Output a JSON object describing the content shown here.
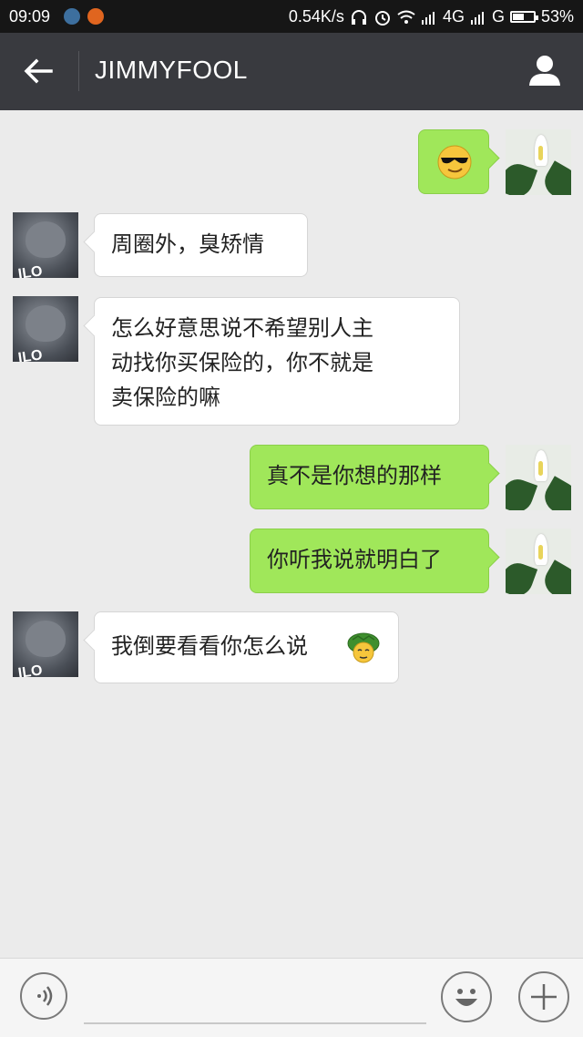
{
  "status_bar": {
    "time": "09:09",
    "network_speed": "0.54K/s",
    "network_4g": "4G",
    "network_g": "G",
    "battery": "53%",
    "battery_level": 0.53
  },
  "header": {
    "title": "JIMMYFOOL",
    "back_icon": "arrow-left-icon",
    "profile_icon": "person-icon"
  },
  "avatars": {
    "contact_text": "ILO"
  },
  "messages": [
    {
      "direction": "out",
      "text": "",
      "emoji": "sunglasses-smiley"
    },
    {
      "direction": "in",
      "text": "周圈外，臭矫情"
    },
    {
      "direction": "in",
      "lines": [
        "怎么好意思说不希望别人主",
        "动找你买保险的，你不就是",
        "卖保险的嘛"
      ]
    },
    {
      "direction": "out",
      "text": "真不是你想的那样"
    },
    {
      "direction": "out",
      "text": "你听我说就明白了"
    },
    {
      "direction": "in",
      "text": "我倒要看看你怎么说",
      "emoji": "turtle-emoji"
    }
  ],
  "input_bar": {
    "voice_icon": "voice-icon",
    "emoji_icon": "smiley-icon",
    "plus_icon": "plus-icon"
  },
  "colors": {
    "header_bg": "#393a3f",
    "chat_bg": "#ebebeb",
    "outgoing_bubble": "#a0e75a",
    "incoming_bubble": "#ffffff"
  }
}
